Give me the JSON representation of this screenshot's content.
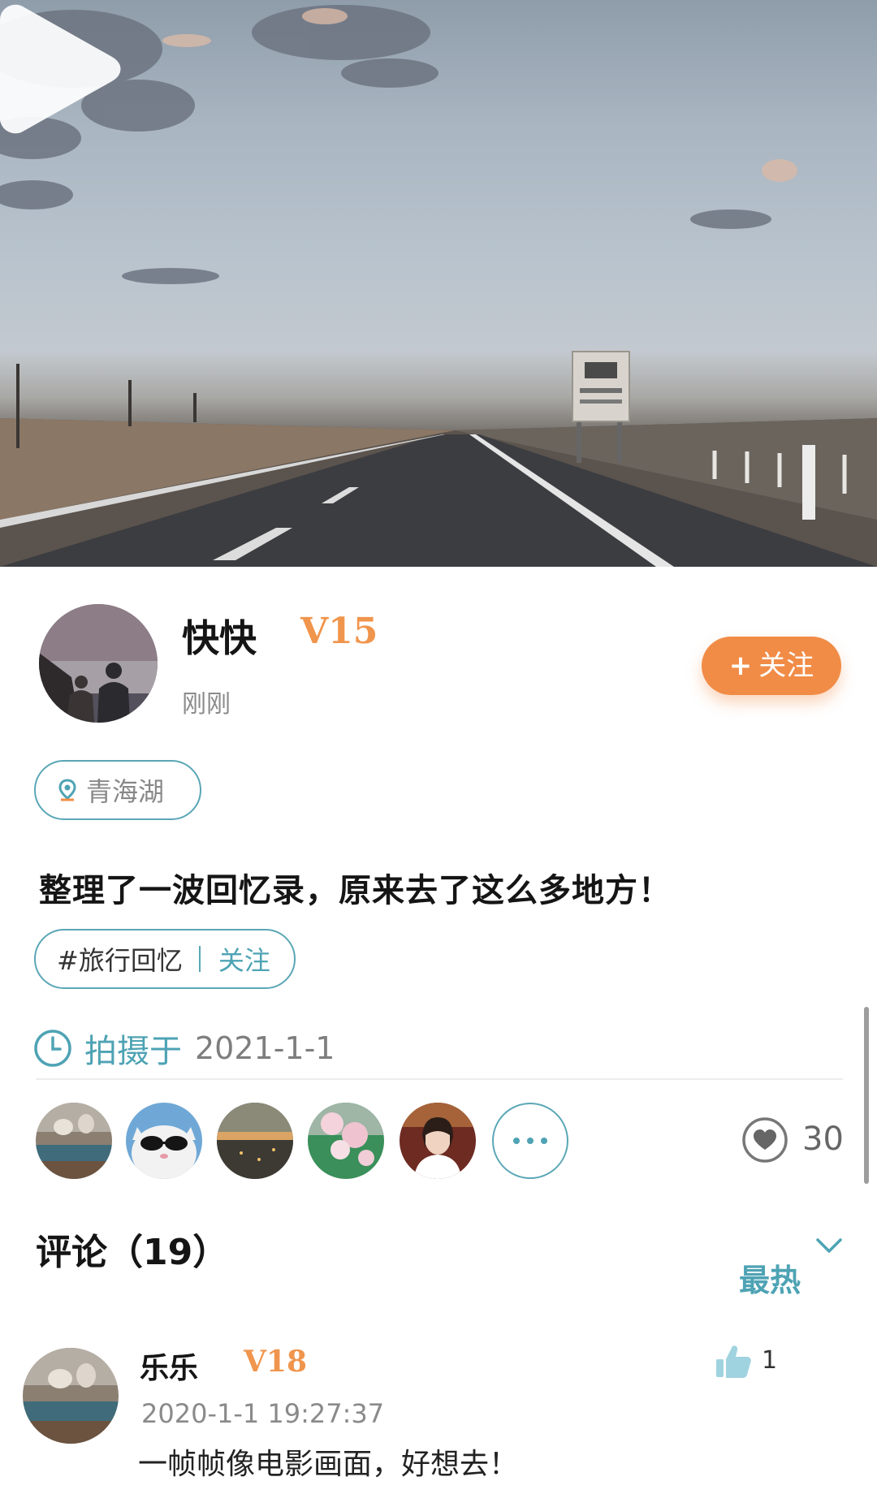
{
  "video": {
    "play_icon": "play-icon"
  },
  "author": {
    "name": "快快",
    "level": "V15",
    "time": "刚刚",
    "follow_label": "关注",
    "follow_icon": "plus-icon"
  },
  "location": {
    "icon": "location-pin-icon",
    "label": "青海湖"
  },
  "post": {
    "text": "整理了一波回忆录，原来去了这么多地方！"
  },
  "topic": {
    "name": "#旅行回忆",
    "follow_label": "关注"
  },
  "shot": {
    "icon": "clock-icon",
    "label": "拍摄于",
    "date": "2021-1-1"
  },
  "likes": {
    "count": "30",
    "icon": "heart-icon",
    "likers": [
      "avatar-dogs",
      "avatar-cat-sunglasses",
      "avatar-city-sunset",
      "avatar-blossoms",
      "avatar-woman"
    ],
    "more_icon": "more-dots-icon"
  },
  "comments": {
    "title": "评论（19）",
    "sort_label": "最热",
    "sort_icon": "chevron-down-icon",
    "items": [
      {
        "user": "乐乐",
        "level": "V18",
        "time": "2020-1-1  19:27:37",
        "text": "一帧帧像电影画面，好想去！",
        "likes": "1",
        "like_icon": "thumbs-up-icon"
      }
    ]
  },
  "colors": {
    "accent": "#4ea3b4",
    "orange": "#f18c47",
    "level": "#f0954d"
  }
}
